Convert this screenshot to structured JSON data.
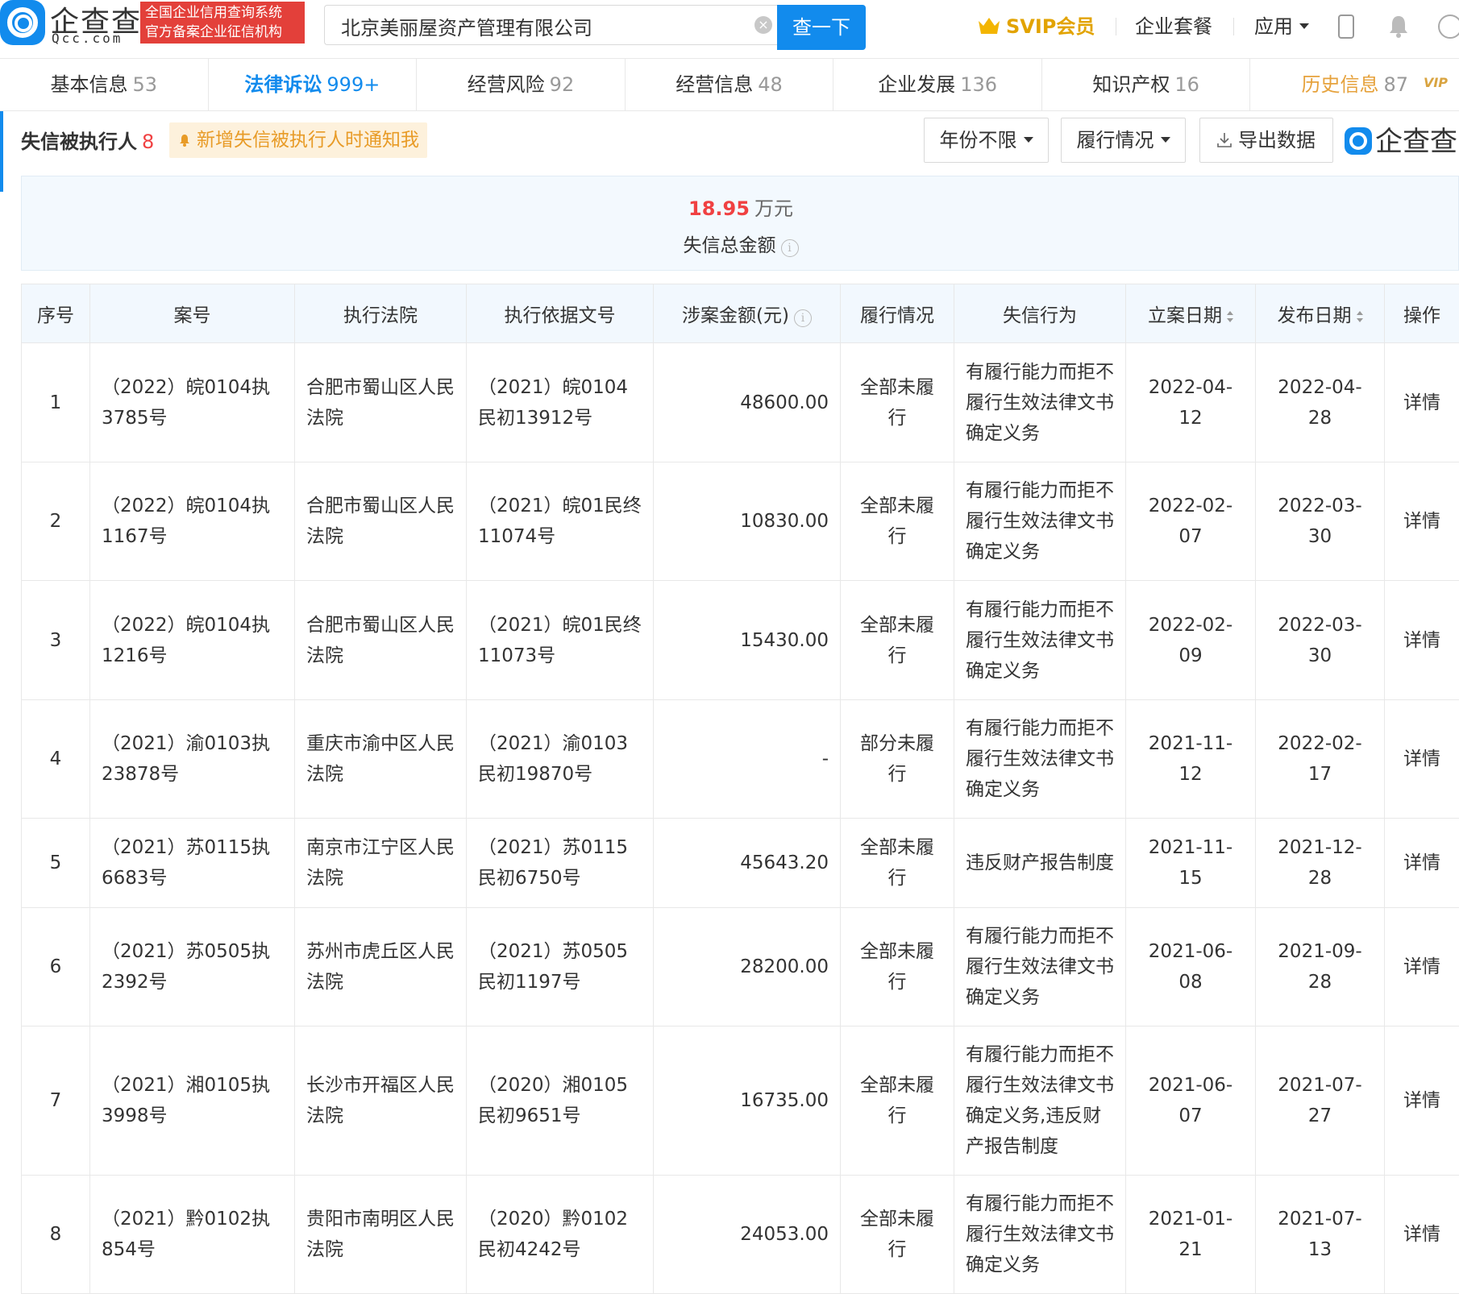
{
  "header": {
    "logo_text": "企查查",
    "logo_sub": "Qcc.com",
    "badge_line1": "全国企业信用查询系统",
    "badge_line2": "官方备案企业征信机构",
    "search_value": "北京美丽屋资产管理有限公司",
    "search_button": "查一下",
    "svip_label": "SVIP会员",
    "nav_package": "企业套餐",
    "nav_apps": "应用"
  },
  "tabs": [
    {
      "label": "基本信息",
      "count": "53"
    },
    {
      "label": "法律诉讼",
      "count": "999+"
    },
    {
      "label": "经营风险",
      "count": "92"
    },
    {
      "label": "经营信息",
      "count": "48"
    },
    {
      "label": "企业发展",
      "count": "136"
    },
    {
      "label": "知识产权",
      "count": "16"
    },
    {
      "label": "历史信息",
      "count": "87",
      "tag": "VIP"
    }
  ],
  "section": {
    "title": "失信被执行人",
    "count": "8",
    "notify": "新增失信被执行人时通知我",
    "filter_year": "年份不限",
    "filter_status": "履行情况",
    "export": "导出数据",
    "brand": "企查查"
  },
  "summary": {
    "amount": "18.95",
    "unit": "万元",
    "label": "失信总金额"
  },
  "table": {
    "headers": [
      "序号",
      "案号",
      "执行法院",
      "执行依据文号",
      "涉案金额(元)",
      "履行情况",
      "失信行为",
      "立案日期",
      "发布日期",
      "操作"
    ],
    "rows": [
      {
        "no": "1",
        "case": "（2022）皖0104执3785号",
        "court": "合肥市蜀山区人民法院",
        "basis": "（2021）皖0104民初13912号",
        "amount": "48600.00",
        "status": "全部未履行",
        "behavior": "有履行能力而拒不履行生效法律文书确定义务",
        "filed": "2022-04-12",
        "published": "2022-04-28",
        "op": "详情"
      },
      {
        "no": "2",
        "case": "（2022）皖0104执1167号",
        "court": "合肥市蜀山区人民法院",
        "basis": "（2021）皖01民终11074号",
        "amount": "10830.00",
        "status": "全部未履行",
        "behavior": "有履行能力而拒不履行生效法律文书确定义务",
        "filed": "2022-02-07",
        "published": "2022-03-30",
        "op": "详情"
      },
      {
        "no": "3",
        "case": "（2022）皖0104执1216号",
        "court": "合肥市蜀山区人民法院",
        "basis": "（2021）皖01民终11073号",
        "amount": "15430.00",
        "status": "全部未履行",
        "behavior": "有履行能力而拒不履行生效法律文书确定义务",
        "filed": "2022-02-09",
        "published": "2022-03-30",
        "op": "详情"
      },
      {
        "no": "4",
        "case": "（2021）渝0103执23878号",
        "court": "重庆市渝中区人民法院",
        "basis": "（2021）渝0103民初19870号",
        "amount": "-",
        "status": "部分未履行",
        "behavior": "有履行能力而拒不履行生效法律文书确定义务",
        "filed": "2021-11-12",
        "published": "2022-02-17",
        "op": "详情"
      },
      {
        "no": "5",
        "case": "（2021）苏0115执6683号",
        "court": "南京市江宁区人民法院",
        "basis": "（2021）苏0115民初6750号",
        "amount": "45643.20",
        "status": "全部未履行",
        "behavior": "违反财产报告制度",
        "filed": "2021-11-15",
        "published": "2021-12-28",
        "op": "详情"
      },
      {
        "no": "6",
        "case": "（2021）苏0505执2392号",
        "court": "苏州市虎丘区人民法院",
        "basis": "（2021）苏0505民初1197号",
        "amount": "28200.00",
        "status": "全部未履行",
        "behavior": "有履行能力而拒不履行生效法律文书确定义务",
        "filed": "2021-06-08",
        "published": "2021-09-28",
        "op": "详情"
      },
      {
        "no": "7",
        "case": "（2021）湘0105执3998号",
        "court": "长沙市开福区人民法院",
        "basis": "（2020）湘0105民初9651号",
        "amount": "16735.00",
        "status": "全部未履行",
        "behavior": "有履行能力而拒不履行生效法律文书确定义务,违反财产报告制度",
        "filed": "2021-06-07",
        "published": "2021-07-27",
        "op": "详情"
      },
      {
        "no": "8",
        "case": "（2021）黔0102执854号",
        "court": "贵阳市南明区人民法院",
        "basis": "（2020）黔0102民初4242号",
        "amount": "24053.00",
        "status": "全部未履行",
        "behavior": "有履行能力而拒不履行生效法律文书确定义务",
        "filed": "2021-01-21",
        "published": "2021-07-13",
        "op": "详情"
      }
    ]
  },
  "colors": {
    "brand_blue": "#128bed",
    "alert_red": "#f04142",
    "svip_gold": "#e2a300",
    "notify_orange": "#e89b27"
  }
}
